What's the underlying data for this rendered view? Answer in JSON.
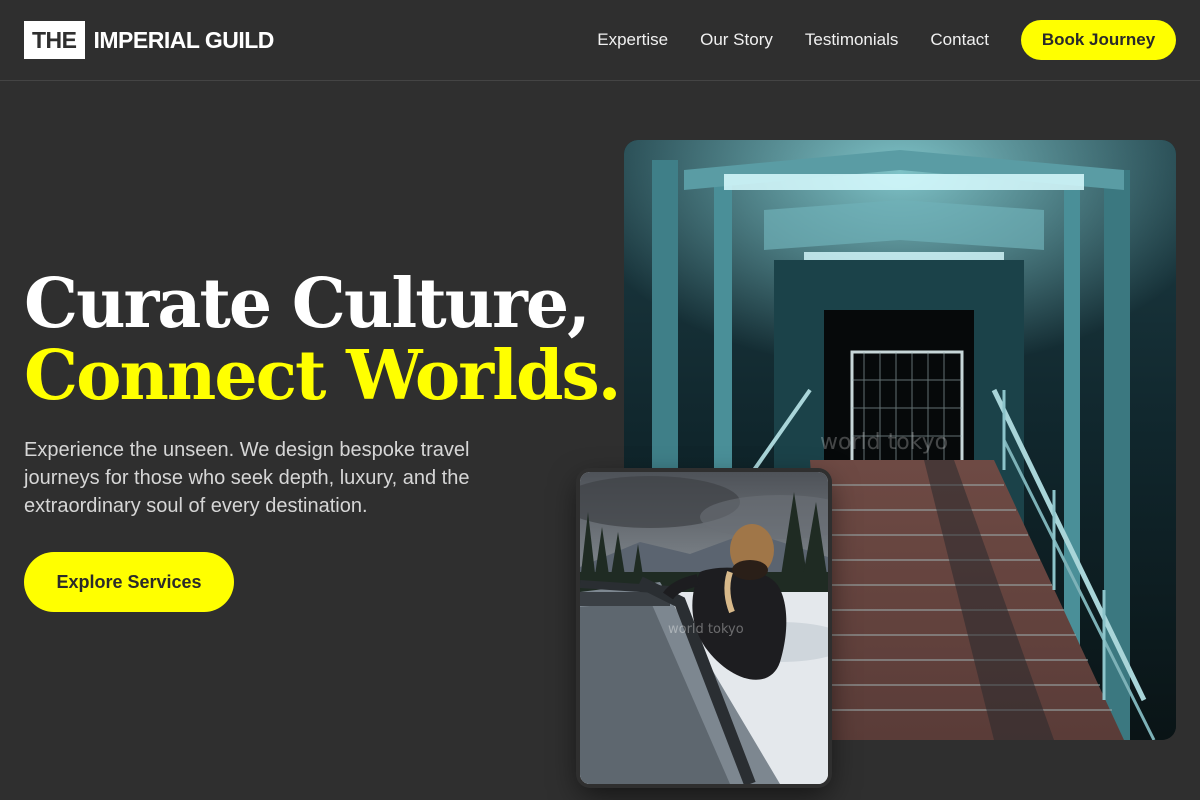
{
  "brand": {
    "box_text": "THE",
    "name": "IMPERIAL GUILD"
  },
  "nav": {
    "items": [
      {
        "label": "Expertise"
      },
      {
        "label": "Our Story"
      },
      {
        "label": "Testimonials"
      },
      {
        "label": "Contact"
      }
    ],
    "cta_label": "Book Journey"
  },
  "hero": {
    "title_line1": "Curate Culture,",
    "title_line2": "Connect Worlds.",
    "subtitle": "Experience the unseen. We design bespoke travel journeys for those who seek depth, luxury, and the extraordinary soul of every destination.",
    "cta_label": "Explore Services"
  },
  "images": {
    "large": {
      "subject": "illuminated-staircase-tunnel",
      "watermark": "world tokyo"
    },
    "small": {
      "subject": "traveler-in-snowy-landscape",
      "watermark": "world tokyo"
    }
  },
  "colors": {
    "background": "#2f2f2f",
    "accent": "#ffff00",
    "text": "#ffffff",
    "muted_text": "#d6d6d6"
  }
}
